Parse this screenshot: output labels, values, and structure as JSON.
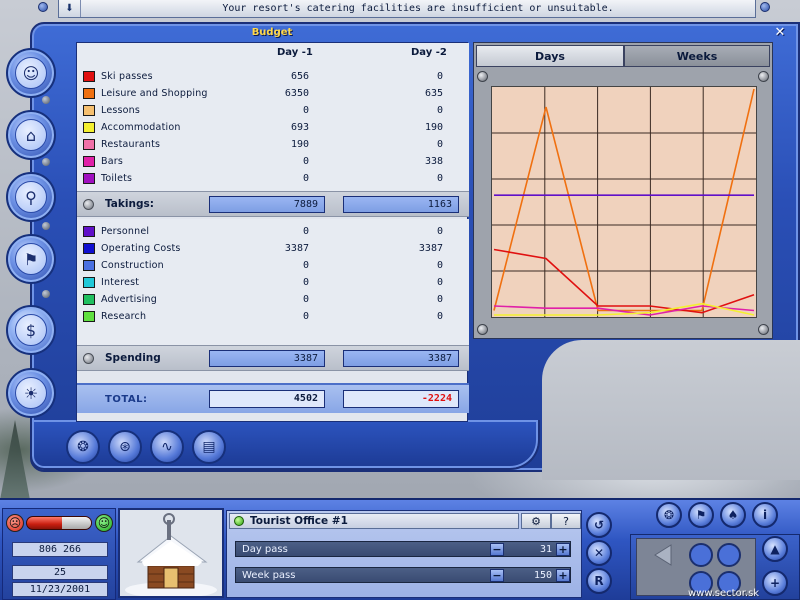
{
  "message": "Your resort's catering facilities are insufficient or unsuitable.",
  "panel_title": "Budget",
  "columns": [
    "Day -1",
    "Day -2"
  ],
  "takings_items": [
    {
      "label": "Ski passes",
      "color": "#e01010",
      "d1": "656",
      "d2": "0"
    },
    {
      "label": "Leisure and Shopping",
      "color": "#f07010",
      "d1": "6350",
      "d2": "635"
    },
    {
      "label": "Lessons",
      "color": "#f6c070",
      "d1": "0",
      "d2": "0"
    },
    {
      "label": "Accommodation",
      "color": "#f4f030",
      "d1": "693",
      "d2": "190"
    },
    {
      "label": "Restaurants",
      "color": "#f070a8",
      "d1": "190",
      "d2": "0"
    },
    {
      "label": "Bars",
      "color": "#e020a8",
      "d1": "0",
      "d2": "338"
    },
    {
      "label": "Toilets",
      "color": "#a010c0",
      "d1": "0",
      "d2": "0"
    }
  ],
  "takings": {
    "label": "Takings:",
    "d1": "7889",
    "d2": "1163"
  },
  "spending_items": [
    {
      "label": "Personnel",
      "color": "#6010c8",
      "d1": "0",
      "d2": "0"
    },
    {
      "label": "Operating Costs",
      "color": "#1010d0",
      "d1": "3387",
      "d2": "3387"
    },
    {
      "label": "Construction",
      "color": "#4a70e0",
      "d1": "0",
      "d2": "0"
    },
    {
      "label": "Interest",
      "color": "#20c8d8",
      "d1": "0",
      "d2": "0"
    },
    {
      "label": "Advertising",
      "color": "#20c060",
      "d1": "0",
      "d2": "0"
    },
    {
      "label": "Research",
      "color": "#60e040",
      "d1": "0",
      "d2": "0"
    }
  ],
  "spending": {
    "label": "Spending",
    "d1": "3387",
    "d2": "3387"
  },
  "total": {
    "label": "TOTAL:",
    "d1": "4502",
    "d2": "-2224",
    "d1_color": "#0b1a3c",
    "d2_color": "#e01010"
  },
  "graph_tabs": {
    "days": "Days",
    "weeks": "Weeks",
    "selected": "days"
  },
  "chart_data": {
    "type": "line",
    "ylim": [
      0,
      100
    ],
    "grid": true,
    "series": [
      {
        "color": "#f07010",
        "values": [
          2,
          92,
          2,
          2,
          2,
          100
        ]
      },
      {
        "color": "#6010c8",
        "values": [
          53,
          53,
          53,
          53,
          53,
          53
        ]
      },
      {
        "color": "#e01010",
        "values": [
          29,
          25,
          4,
          4,
          1,
          9
        ]
      },
      {
        "color": "#e020a8",
        "values": [
          4,
          3,
          3,
          0,
          4,
          2
        ]
      },
      {
        "color": "#f4f030",
        "values": [
          0,
          0,
          0,
          1,
          5,
          0
        ]
      }
    ]
  },
  "hud": {
    "money": "806 266",
    "day": "25",
    "date": "11/23/2001",
    "mood_level": 0.55,
    "building_title": "Tourist Office #1",
    "passes": [
      {
        "label": "Day pass",
        "value": "31"
      },
      {
        "label": "Week pass",
        "value": "150"
      }
    ]
  },
  "watermark": "www.sector.sk",
  "colors": {
    "frame": "#2a4fb6",
    "accent": "#ffd84a"
  }
}
